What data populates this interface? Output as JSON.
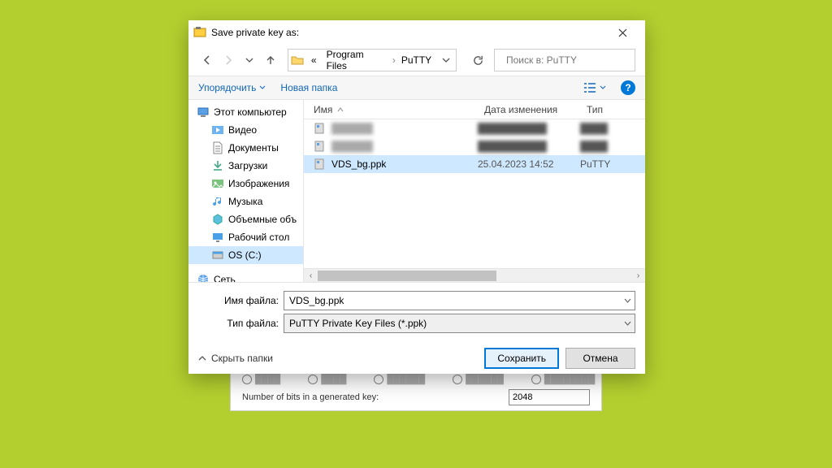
{
  "putty": {
    "bits_label": "Number of bits in a generated key:",
    "bits_value": "2048"
  },
  "dialog": {
    "title": "Save private key as:"
  },
  "nav": {
    "crumb_prefix": "«",
    "crumb1": "Program Files",
    "crumb2": "PuTTY",
    "search_placeholder": "Поиск в: PuTTY"
  },
  "toolbar": {
    "organize": "Упорядочить",
    "newfolder": "Новая папка"
  },
  "tree": {
    "this_pc": "Этот компьютер",
    "video": "Видео",
    "documents": "Документы",
    "downloads": "Загрузки",
    "pictures": "Изображения",
    "music": "Музыка",
    "objects3d": "Объемные объ",
    "desktop": "Рабочий стол",
    "osc": "OS (C:)",
    "network": "Сеть"
  },
  "columns": {
    "name": "Имя",
    "date": "Дата изменения",
    "type": "Тип"
  },
  "files": [
    {
      "name": "██████",
      "date": "██████████",
      "type": "████",
      "blur": true,
      "selected": false
    },
    {
      "name": "██████",
      "date": "██████████",
      "type": "████",
      "blur": true,
      "selected": false
    },
    {
      "name": "VDS_bg.ppk",
      "date": "25.04.2023 14:52",
      "type": "PuTTY",
      "blur": false,
      "selected": true
    }
  ],
  "bottom": {
    "filename_label": "Имя файла:",
    "filename_value": "VDS_bg.ppk",
    "filetype_label": "Тип файла:",
    "filetype_value": "PuTTY Private Key Files (*.ppk)",
    "hide_folders": "Скрыть папки",
    "save": "Сохранить",
    "cancel": "Отмена"
  }
}
